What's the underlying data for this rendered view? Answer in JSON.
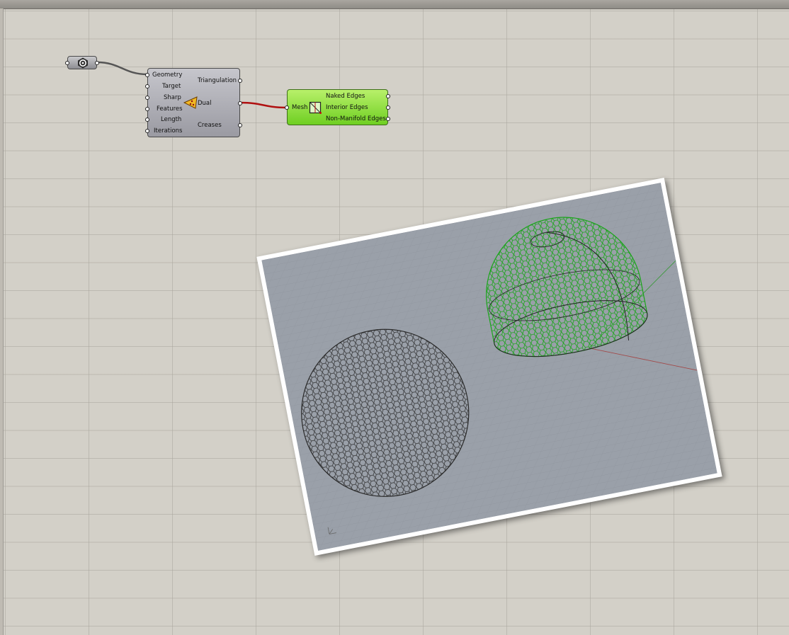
{
  "components": {
    "param": {
      "icon": "hexagon-param-icon"
    },
    "remesh": {
      "inputs": [
        "Geometry",
        "Target",
        "Sharp",
        "Features",
        "Length",
        "Iterations"
      ],
      "outputs": [
        "Triangulation",
        "Dual",
        "Creases"
      ],
      "icon": "triangle-mesh-icon"
    },
    "mesh_edges": {
      "input": "Mesh",
      "outputs": [
        "Naked Edges",
        "Interior Edges",
        "Non-Manifold Edges"
      ],
      "icon": "mesh-edges-icon"
    }
  },
  "colors": {
    "canvas": "#d3d0c8",
    "wire_default": "#5a5a5a",
    "wire_selected": "#b01010",
    "component_green": "#8ede3a",
    "mesh_green": "#1aa51a",
    "mesh_dark": "#2a2a2a"
  }
}
